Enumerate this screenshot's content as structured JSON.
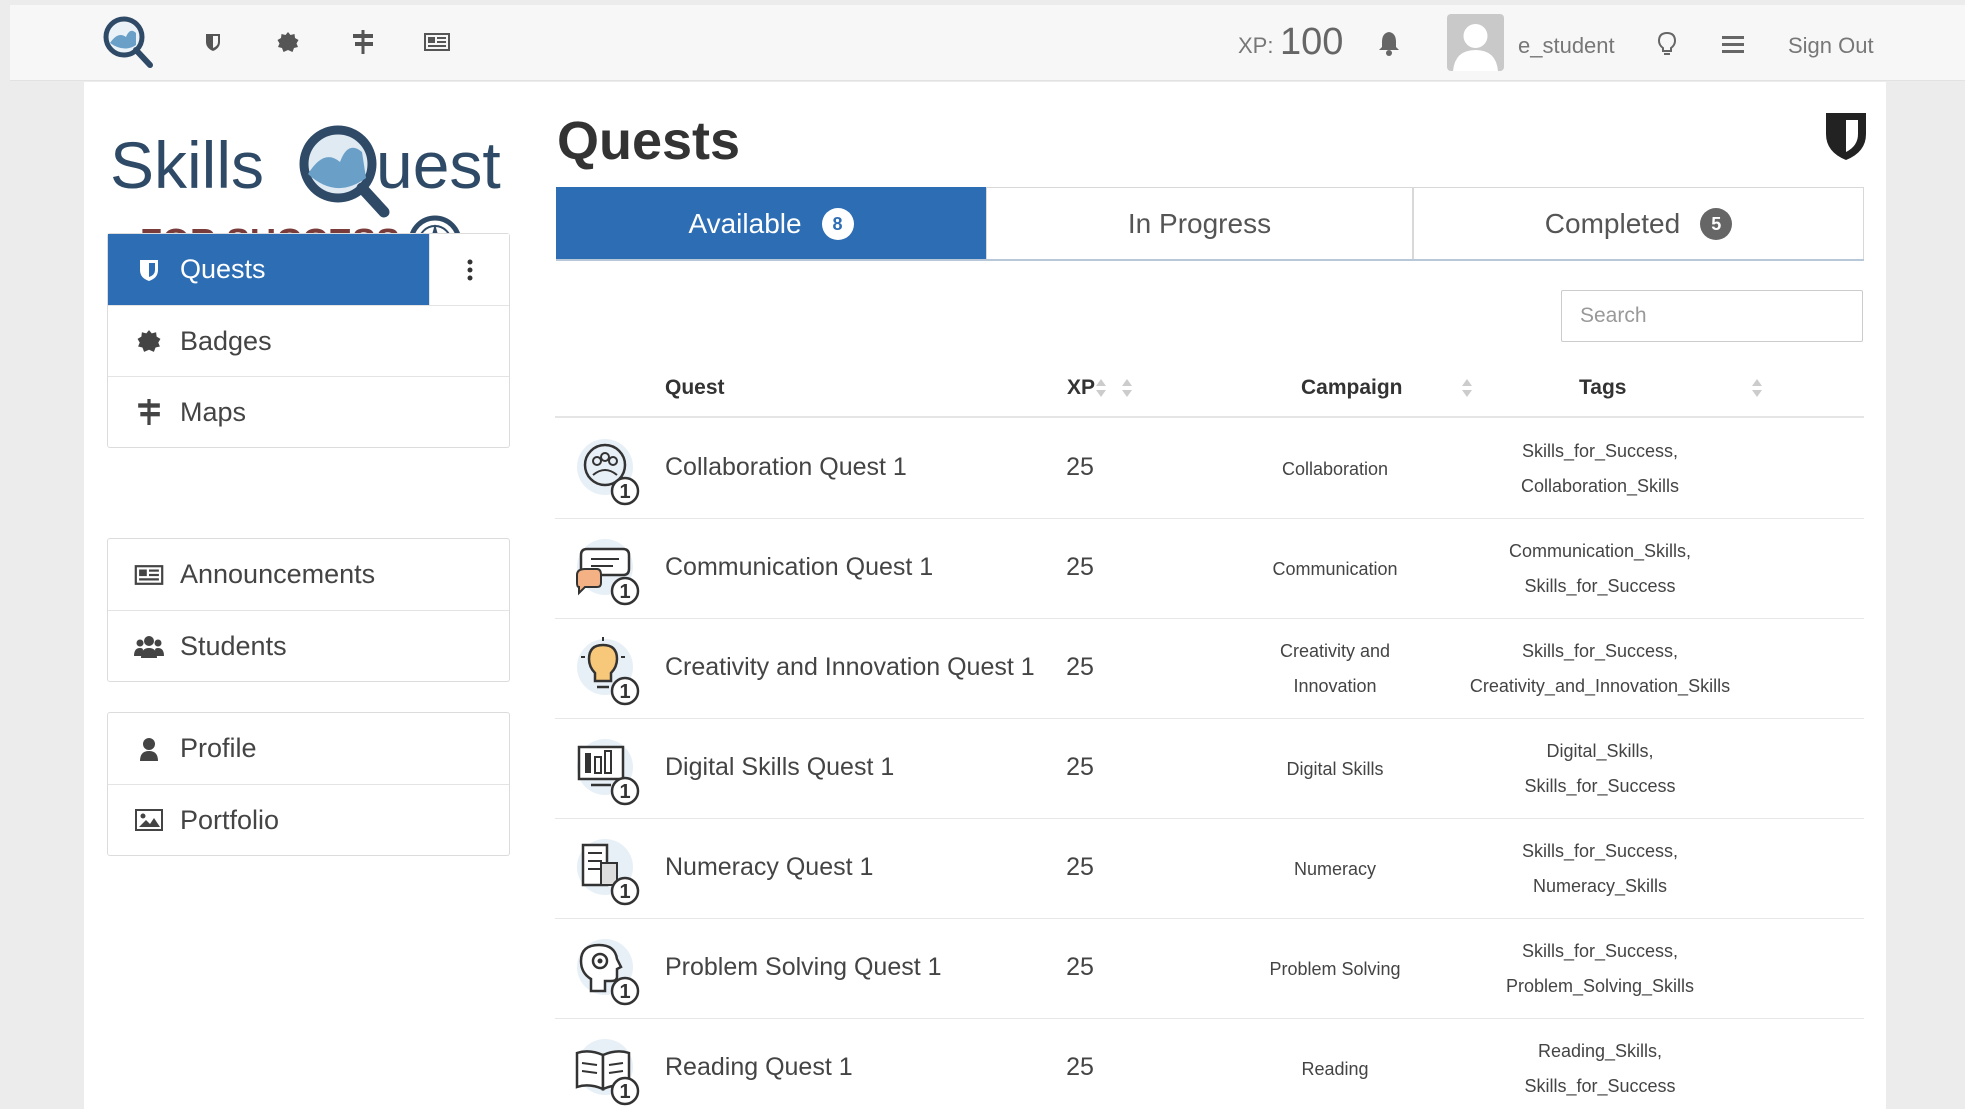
{
  "topnav": {
    "xp_label": "XP:",
    "xp_value": "100",
    "username": "e_student",
    "signout": "Sign Out"
  },
  "brand": {
    "line1": "Skills",
    "line2": "uest",
    "tagline": "FOR SUCCESS"
  },
  "sidebar": {
    "groups": [
      [
        {
          "label": "Quests",
          "icon": "shield-icon",
          "active": true
        },
        {
          "label": "Badges",
          "icon": "badge-icon"
        },
        {
          "label": "Maps",
          "icon": "signpost-icon"
        }
      ],
      [
        {
          "label": "Announcements",
          "icon": "newspaper-icon"
        },
        {
          "label": "Students",
          "icon": "users-icon"
        }
      ],
      [
        {
          "label": "Profile",
          "icon": "user-icon"
        },
        {
          "label": "Portfolio",
          "icon": "image-icon"
        }
      ]
    ]
  },
  "page": {
    "title": "Quests"
  },
  "tabs": [
    {
      "label": "Available",
      "count": "8",
      "active": true
    },
    {
      "label": "In Progress",
      "count": ""
    },
    {
      "label": "Completed",
      "count": "5"
    }
  ],
  "search": {
    "placeholder": "Search"
  },
  "table": {
    "headers": {
      "quest": "Quest",
      "xp": "XP",
      "campaign": "Campaign",
      "tags": "Tags"
    },
    "rows": [
      {
        "icon": "collaboration-quest-icon",
        "name": "Collaboration Quest 1",
        "xp": "25",
        "campaign": "Collaboration",
        "tags": [
          "Skills_for_Success,",
          "Collaboration_Skills"
        ]
      },
      {
        "icon": "communication-quest-icon",
        "name": "Communication Quest 1",
        "xp": "25",
        "campaign": "Communication",
        "tags": [
          "Communication_Skills,",
          "Skills_for_Success"
        ]
      },
      {
        "icon": "creativity-quest-icon",
        "name": "Creativity and Innovation Quest 1",
        "xp": "25",
        "campaign": "Creativity and Innovation",
        "tags": [
          "Skills_for_Success,",
          "Creativity_and_Innovation_Skills"
        ]
      },
      {
        "icon": "digital-quest-icon",
        "name": "Digital Skills Quest 1",
        "xp": "25",
        "campaign": "Digital Skills",
        "tags": [
          "Digital_Skills,",
          "Skills_for_Success"
        ]
      },
      {
        "icon": "numeracy-quest-icon",
        "name": "Numeracy Quest 1",
        "xp": "25",
        "campaign": "Numeracy",
        "tags": [
          "Skills_for_Success,",
          "Numeracy_Skills"
        ]
      },
      {
        "icon": "problem-solving-quest-icon",
        "name": "Problem Solving Quest 1",
        "xp": "25",
        "campaign": "Problem Solving",
        "tags": [
          "Skills_for_Success,",
          "Problem_Solving_Skills"
        ]
      },
      {
        "icon": "reading-quest-icon",
        "name": "Reading Quest 1",
        "xp": "25",
        "campaign": "Reading",
        "tags": [
          "Reading_Skills,",
          "Skills_for_Success"
        ]
      }
    ]
  },
  "colors": {
    "primary": "#2d6db4",
    "brand_navy": "#2f4a66",
    "brand_maroon": "#7a3b3b"
  }
}
